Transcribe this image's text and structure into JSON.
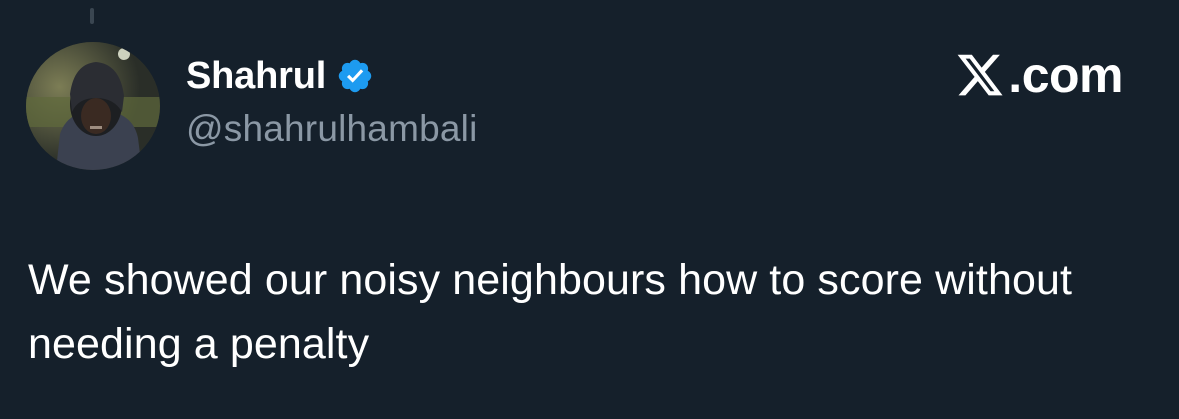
{
  "author": {
    "display_name": "Shahrul",
    "handle": "@shahrulhambali",
    "verified": true,
    "avatar_icon": "profile-photo"
  },
  "brand": {
    "logo_icon": "x-logo-icon",
    "text": ".com"
  },
  "tweet": {
    "text": "We showed our noisy neighbours how to score without needing a penalty"
  },
  "colors": {
    "background": "#15202b",
    "handle": "#8b98a5",
    "verified": "#1d9bf0",
    "text": "#ffffff"
  }
}
